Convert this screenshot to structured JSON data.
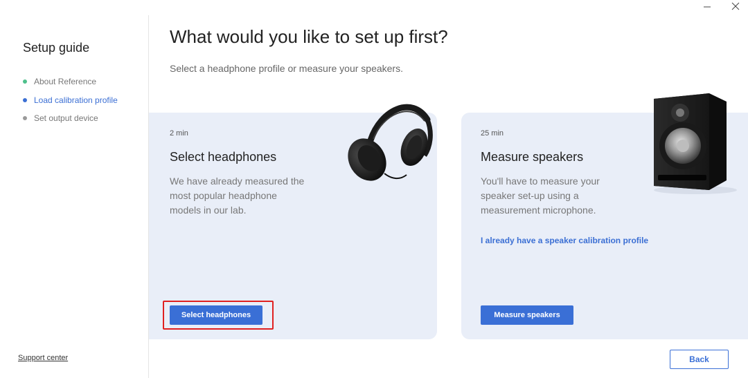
{
  "sidebar": {
    "title": "Setup guide",
    "steps": [
      {
        "label": "About Reference",
        "state": "done"
      },
      {
        "label": "Load calibration profile",
        "state": "active"
      },
      {
        "label": "Set output device",
        "state": "todo"
      }
    ],
    "support_link": "Support center"
  },
  "main": {
    "title": "What would you like to set up first?",
    "subtitle": "Select a headphone profile or measure your speakers."
  },
  "cards": {
    "headphones": {
      "time": "2 min",
      "title": "Select headphones",
      "description": "We have already measured the most popular headphone models in our lab.",
      "button_label": "Select headphones",
      "image_icon": "headphones-icon"
    },
    "speakers": {
      "time": "25 min",
      "title": "Measure speakers",
      "description": "You'll have to measure your speaker set-up using a measurement microphone.",
      "link_label": "I already have a speaker calibration profile",
      "button_label": "Measure speakers",
      "image_icon": "speaker-icon"
    }
  },
  "footer": {
    "back_label": "Back"
  },
  "colors": {
    "accent": "#3a6fd6",
    "card_bg": "#e9eef8",
    "done_dot": "#4ec08c",
    "highlight": "#e02020"
  }
}
